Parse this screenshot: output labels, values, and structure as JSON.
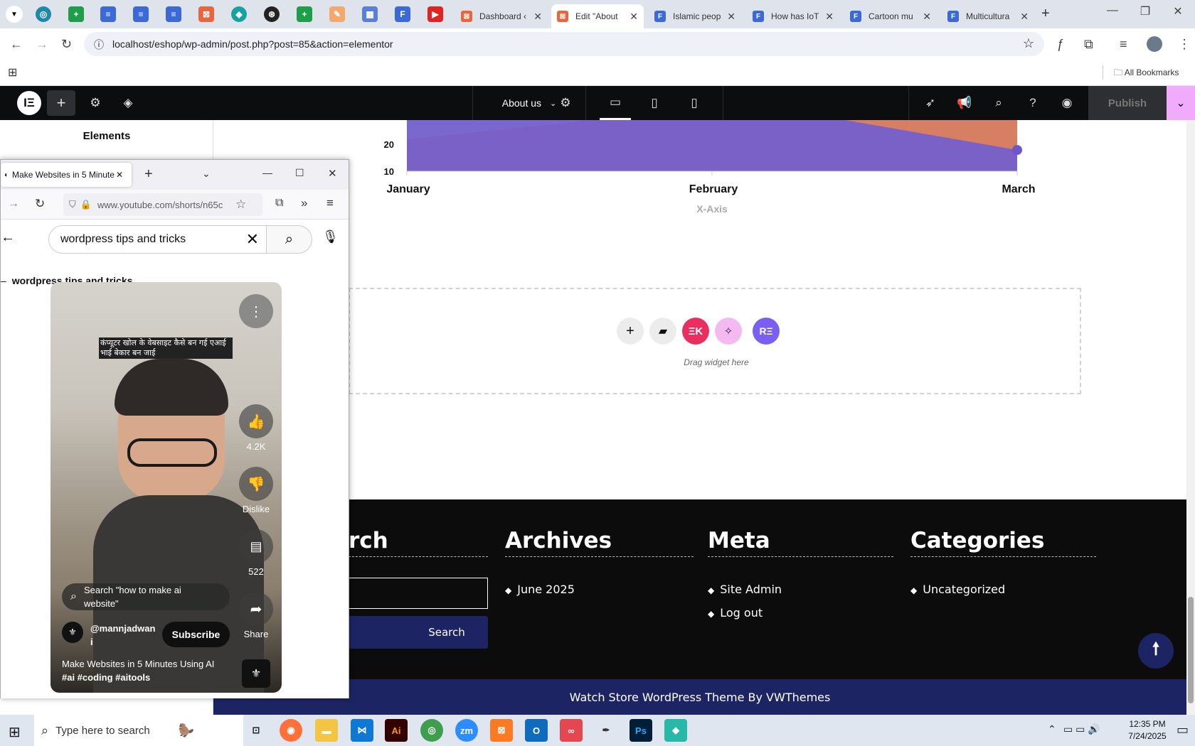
{
  "browser": {
    "tabs": [
      {
        "title": "Dashboard ‹",
        "color": "#e8663d"
      },
      {
        "title": "Edit \"About",
        "color": "#e8663d",
        "active": true
      },
      {
        "title": "Islamic peop",
        "color": "#3b6ad8"
      },
      {
        "title": "How has IoT",
        "color": "#3b6ad8"
      },
      {
        "title": "Cartoon mu",
        "color": "#3b6ad8"
      },
      {
        "title": "Multicultura",
        "color": "#3b6ad8"
      }
    ],
    "url": "localhost/eshop/wp-admin/post.php?post=85&action=elementor",
    "all_bookmarks": "All Bookmarks"
  },
  "elementor": {
    "page_name": "About us",
    "panel_title": "Elements",
    "publish": "Publish",
    "drag_hint": "Drag widget here"
  },
  "chart_data": {
    "type": "area",
    "categories": [
      "January",
      "February",
      "March"
    ],
    "xlabel": "X-Axis",
    "ylabel": "",
    "yticks": [
      "20",
      "10"
    ],
    "series": [
      {
        "values": [
          30,
          40,
          15
        ],
        "color": "#7460cc"
      },
      {
        "values": [
          20,
          35,
          35
        ],
        "color": "#d4785a"
      }
    ]
  },
  "footer": {
    "search_heading": "rch",
    "search_button": "Search",
    "archives_heading": "Archives",
    "archives_items": [
      "June 2025"
    ],
    "meta_heading": "Meta",
    "meta_items": [
      "Site Admin",
      "Log out"
    ],
    "categories_heading": "Categories",
    "categories_items": [
      "Uncategorized"
    ],
    "copyright": "Watch Store WordPress Theme By VWThemes"
  },
  "firefox": {
    "tab_title": "Make Websites in 5 Minute",
    "url": "www.youtube.com/shorts/n65c",
    "search_value": "wordpress tips and tricks",
    "suggestion": "wordpress tips and tricks",
    "video": {
      "overlay_text": "कंप्यूटर खोल के वेबसाइट कैसे बन गई एआई भाई बेकार बन जाई",
      "likes": "4.2K",
      "dislike": "Dislike",
      "comments": "522",
      "share": "Share",
      "search_chip": "Search \"how to make ai website\"",
      "channel": "@mannjadwani",
      "subscribe": "Subscribe",
      "title": "Make Websites in 5 Minutes Using AI",
      "hashtags": "#ai #coding #aitools"
    }
  },
  "taskbar": {
    "search_placeholder": "Type here to search",
    "time": "12:35 PM",
    "date": "7/24/2025"
  }
}
